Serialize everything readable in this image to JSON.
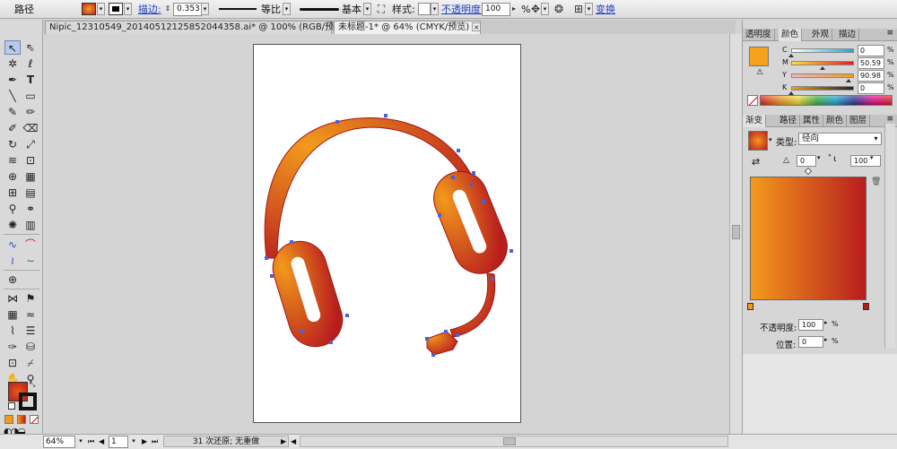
{
  "control_bar": {
    "object_type": "路径",
    "stroke_label": "描边:",
    "stroke_weight": "0.353",
    "stroke_profile": "等比",
    "brush": "基本",
    "style_label": "样式:",
    "opacity_label": "不透明度:",
    "opacity_value": "100",
    "opacity_unit": "%",
    "transform_label": "变换",
    "icons": [
      "fill-swatch-icon",
      "stroke-swatch-icon",
      "recolor-icon",
      "align-icon",
      "isolate-icon"
    ]
  },
  "tabs": [
    {
      "title": "Nipic_12310549_20140512125852044358.ai* @ 100% (RGB/预览)",
      "close": "×"
    },
    {
      "title": "未标题-1* @ 64% (CMYK/预览)",
      "close": "×"
    }
  ],
  "status_bar": {
    "zoom": "64%",
    "page": "1",
    "undo_status": "31 次还原; 无重做"
  },
  "color_panel": {
    "tabs": [
      "透明度",
      "颜色",
      "外观",
      "描边"
    ],
    "active_tab": "颜色",
    "swatch_color": "#f3a11e",
    "channels": [
      {
        "label": "C",
        "value": "0",
        "unit": "%",
        "fraction": 0.0
      },
      {
        "label": "M",
        "value": "50.59",
        "unit": "%",
        "fraction": 0.5059
      },
      {
        "label": "Y",
        "value": "90.98",
        "unit": "%",
        "fraction": 0.9098
      },
      {
        "label": "K",
        "value": "0",
        "unit": "%",
        "fraction": 0.0
      }
    ]
  },
  "gradient_panel": {
    "tabs": [
      "渐变",
      "路径",
      "属性",
      "颜色",
      "图层"
    ],
    "active_tab": "渐变",
    "type_label": "类型:",
    "type_value": "径向",
    "angle": "0",
    "angle_unit": "°",
    "aspect": "100",
    "aspect_unit": "%",
    "start_color": "#f39a1d",
    "end_color": "#b81d1d",
    "opacity_label": "不透明度:",
    "opacity_value": "100",
    "opacity_unit": "%",
    "location_label": "位置:",
    "location_value": "0",
    "location_unit": "%"
  },
  "artwork": {
    "gradient_start": "#f39a1d",
    "gradient_end": "#b81d1d",
    "anchor_color": "#4a62d8"
  }
}
